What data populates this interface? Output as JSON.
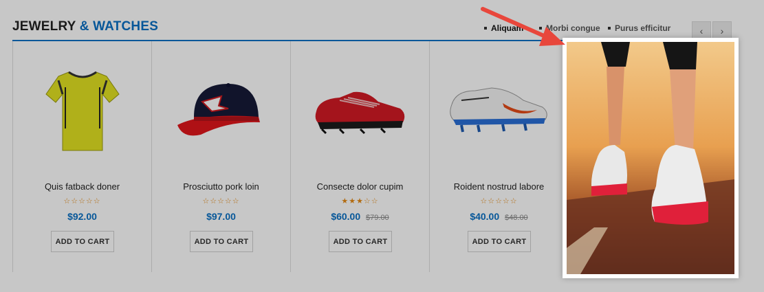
{
  "section": {
    "title_dark": "JEWELRY",
    "title_blue": "& WATCHES"
  },
  "tabs": [
    {
      "label": "Aliquam",
      "active": true
    },
    {
      "label": "Morbi congue",
      "active": false
    },
    {
      "label": "Purus efficitur",
      "active": false
    }
  ],
  "nav": {
    "prev": "‹",
    "next": "›"
  },
  "products": [
    {
      "name": "Quis fatback doner",
      "rating": 0,
      "stars": "☆☆☆☆☆",
      "price": "$92.00",
      "old_price": "",
      "cart": "ADD TO CART"
    },
    {
      "name": "Prosciutto pork loin",
      "rating": 0,
      "stars": "☆☆☆☆☆",
      "price": "$97.00",
      "old_price": "",
      "cart": "ADD TO CART"
    },
    {
      "name": "Consecte dolor cupim",
      "rating": 3,
      "stars": "★★★☆☆",
      "price": "$60.00",
      "old_price": "$79.00",
      "cart": "ADD TO CART"
    },
    {
      "name": "Roident nostrud labore",
      "rating": 0,
      "stars": "☆☆☆☆☆",
      "price": "$40.00",
      "old_price": "$48.00",
      "cart": "ADD TO CART"
    }
  ],
  "colors": {
    "accent": "#0a70c4",
    "star": "#e58a15",
    "arrow": "#e8473c"
  }
}
